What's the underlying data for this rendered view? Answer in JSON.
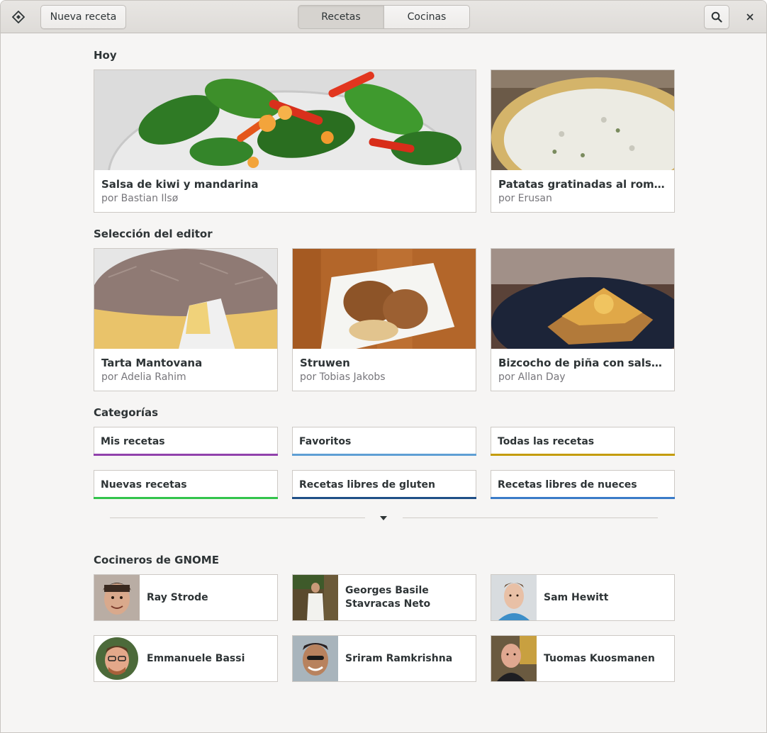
{
  "header": {
    "new_recipe_label": "Nueva receta",
    "tabs": [
      {
        "label": "Recetas",
        "active": true
      },
      {
        "label": "Cocinas",
        "active": false
      }
    ],
    "search_icon": "search-icon",
    "close_icon": "close-icon",
    "app_icon": "gnome-recipes-icon"
  },
  "today": {
    "title": "Hoy",
    "cards": [
      {
        "title": "Salsa de kiwi y mandarina",
        "author": "por Bastian Ilsø"
      },
      {
        "title": "Patatas gratinadas al romero",
        "author": "por Erusan"
      }
    ]
  },
  "editor": {
    "title": "Selección del editor",
    "cards": [
      {
        "title": "Tarta Mantovana",
        "author": "por Adelia Rahim"
      },
      {
        "title": "Struwen",
        "author": "por Tobias Jakobs"
      },
      {
        "title": "Bizcocho de piña con salsa de …",
        "author": "por Allan Day"
      }
    ]
  },
  "categories": {
    "title": "Categorías",
    "items": [
      {
        "label": "Mis recetas",
        "color": "#9141ac"
      },
      {
        "label": "Favoritos",
        "color": "#5e9fd4"
      },
      {
        "label": "Todas las recetas",
        "color": "#c49c0a"
      },
      {
        "label": "Nuevas recetas",
        "color": "#33c44c"
      },
      {
        "label": "Recetas libres de gluten",
        "color": "#1f4f87"
      },
      {
        "label": "Recetas libres de nueces",
        "color": "#3a7bc8"
      }
    ],
    "expand_icon": "pan-down-icon"
  },
  "chefs": {
    "title": "Cocineros de GNOME",
    "items": [
      {
        "name": "Ray Strode"
      },
      {
        "name": "Georges Basile Stavracas Neto"
      },
      {
        "name": "Sam Hewitt"
      },
      {
        "name": "Emmanuele Bassi"
      },
      {
        "name": "Sriram Ramkrishna"
      },
      {
        "name": "Tuomas Kuosmanen"
      }
    ]
  }
}
